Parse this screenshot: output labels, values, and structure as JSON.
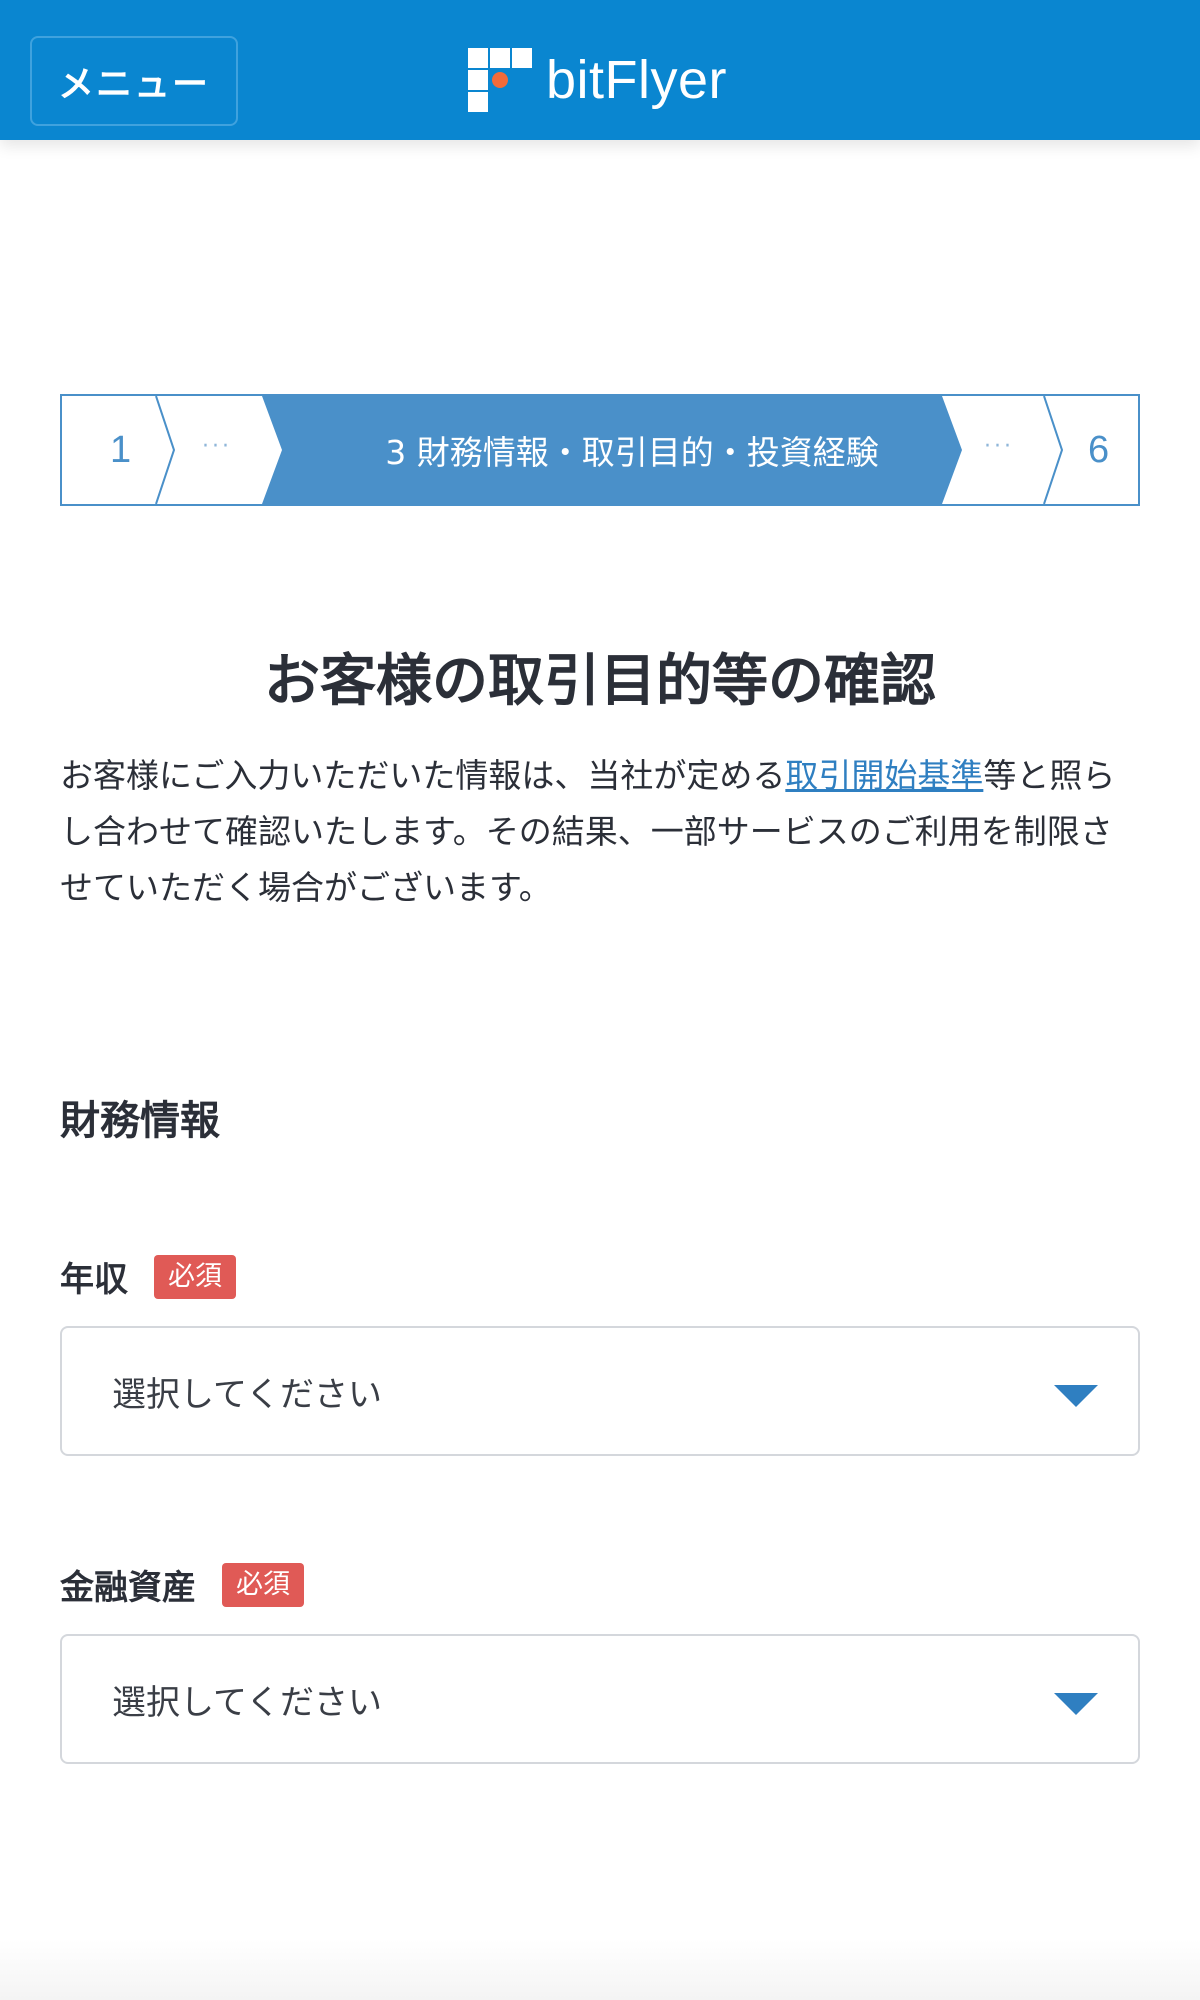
{
  "header": {
    "menu_label": "メニュー",
    "logo_text": "bitFlyer"
  },
  "stepper": {
    "first_step": "1",
    "ellipsis": "···",
    "current_step_label": "3 財務情報・取引目的・投資経験",
    "last_step": "6",
    "current_step": 3,
    "total_steps": 6
  },
  "page": {
    "title": "お客様の取引目的等の確認",
    "desc_before_link": "お客様にご入力いただいた情報は、当社が定める",
    "desc_link": "取引開始基準",
    "desc_after_link": "等と照らし合わせて確認いたします。その結果、一部サービスのご利用を制限させていただく場合がございます。"
  },
  "section": {
    "title": "財務情報"
  },
  "fields": [
    {
      "label": "年収",
      "badge": "必須",
      "value": "選択してください"
    },
    {
      "label": "金融資産",
      "badge": "必須",
      "value": "選択してください"
    }
  ],
  "colors": {
    "header_bg": "#0a86d0",
    "stepper_active": "#4a90c9",
    "link": "#2f7fc1",
    "required_badge": "#e05a56",
    "logo_accent": "#f26b3a"
  }
}
